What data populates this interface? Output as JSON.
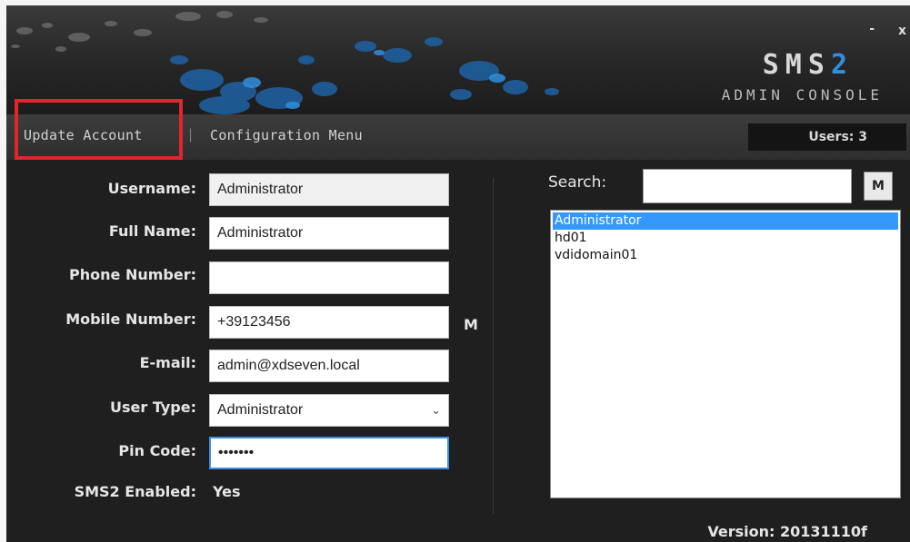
{
  "header": {
    "logo_main": "SMS",
    "logo_accent": "2",
    "logo_sub": "ADMIN CONSOLE",
    "minimize": "-",
    "close": "x"
  },
  "menu": {
    "update_account": "Update Account",
    "separator": "|",
    "configuration_menu": "Configuration Menu",
    "users_count": "Users: 3"
  },
  "form": {
    "username_label": "Username:",
    "username_value": "Administrator",
    "fullname_label": "Full Name:",
    "fullname_value": "Administrator",
    "phone_label": "Phone Number:",
    "phone_value": "",
    "mobile_label": "Mobile Number:",
    "mobile_value": "+39123456",
    "mobile_marker": "M",
    "email_label": "E-mail:",
    "email_value": "admin@xdseven.local",
    "usertype_label": "User Type:",
    "usertype_value": "Administrator",
    "usertype_chevron": "⌄",
    "pin_label": "Pin Code:",
    "pin_value": "•••••••",
    "sms2_label": "SMS2 Enabled:",
    "sms2_value": "Yes"
  },
  "search": {
    "label": "Search:",
    "value": "",
    "m_button": "M"
  },
  "users": [
    {
      "name": "Administrator",
      "selected": true
    },
    {
      "name": "hd01",
      "selected": false
    },
    {
      "name": "vdidomain01",
      "selected": false
    }
  ],
  "footer": {
    "version": "Version: 20131110f"
  },
  "colors": {
    "accent": "#2f8fe0",
    "highlight_box": "#e0262b",
    "selection": "#3399ff"
  }
}
